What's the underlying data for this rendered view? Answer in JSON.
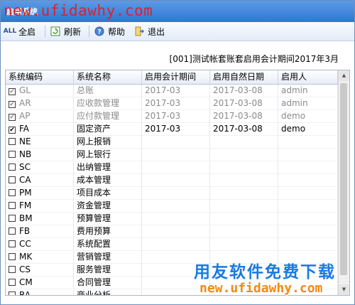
{
  "window": {
    "title": "启用系统"
  },
  "watermark": {
    "top_url": "new.ufidawhy.com",
    "bottom_cn": "用友软件免费下载",
    "bottom_url": "new.ufidawhy.com"
  },
  "toolbar": {
    "select_all_label": "全启",
    "refresh_label": "刷新",
    "help_label": "帮助",
    "exit_label": "退出"
  },
  "period_info": "[001]测试帐套账套启用会计期间2017年3月",
  "table": {
    "headers": [
      "系统编码",
      "系统名称",
      "启用会计期间",
      "启用自然日期",
      "启用人"
    ],
    "rows": [
      {
        "checked": true,
        "code": "GL",
        "name": "总账",
        "period": "2017-03",
        "date": "2017-03-08",
        "user": "admin",
        "dim": true
      },
      {
        "checked": true,
        "code": "AR",
        "name": "应收款管理",
        "period": "2017-03",
        "date": "2017-03-08",
        "user": "admin",
        "dim": true
      },
      {
        "checked": true,
        "code": "AP",
        "name": "应付款管理",
        "period": "2017-03",
        "date": "2017-03-08",
        "user": "demo",
        "dim": true
      },
      {
        "checked": true,
        "code": "FA",
        "name": "固定资产",
        "period": "2017-03",
        "date": "2017-03-08",
        "user": "demo",
        "dim": false
      },
      {
        "checked": false,
        "code": "NE",
        "name": "网上报销",
        "period": "",
        "date": "",
        "user": "",
        "dim": false
      },
      {
        "checked": false,
        "code": "NB",
        "name": "网上银行",
        "period": "",
        "date": "",
        "user": "",
        "dim": false
      },
      {
        "checked": false,
        "code": "SC",
        "name": "出纳管理",
        "period": "",
        "date": "",
        "user": "",
        "dim": false
      },
      {
        "checked": false,
        "code": "CA",
        "name": "成本管理",
        "period": "",
        "date": "",
        "user": "",
        "dim": false
      },
      {
        "checked": false,
        "code": "PM",
        "name": "项目成本",
        "period": "",
        "date": "",
        "user": "",
        "dim": false
      },
      {
        "checked": false,
        "code": "FM",
        "name": "资金管理",
        "period": "",
        "date": "",
        "user": "",
        "dim": false
      },
      {
        "checked": false,
        "code": "BM",
        "name": "预算管理",
        "period": "",
        "date": "",
        "user": "",
        "dim": false
      },
      {
        "checked": false,
        "code": "FB",
        "name": "费用预算",
        "period": "",
        "date": "",
        "user": "",
        "dim": false
      },
      {
        "checked": false,
        "code": "CC",
        "name": "系统配置",
        "period": "",
        "date": "",
        "user": "",
        "dim": false
      },
      {
        "checked": false,
        "code": "MK",
        "name": "营销管理",
        "period": "",
        "date": "",
        "user": "",
        "dim": false
      },
      {
        "checked": false,
        "code": "CS",
        "name": "服务管理",
        "period": "",
        "date": "",
        "user": "",
        "dim": false
      },
      {
        "checked": false,
        "code": "CM",
        "name": "合同管理",
        "period": "",
        "date": "",
        "user": "",
        "dim": false
      },
      {
        "checked": false,
        "code": "RA",
        "name": "商业分析",
        "period": "",
        "date": "",
        "user": "",
        "dim": false
      }
    ]
  }
}
